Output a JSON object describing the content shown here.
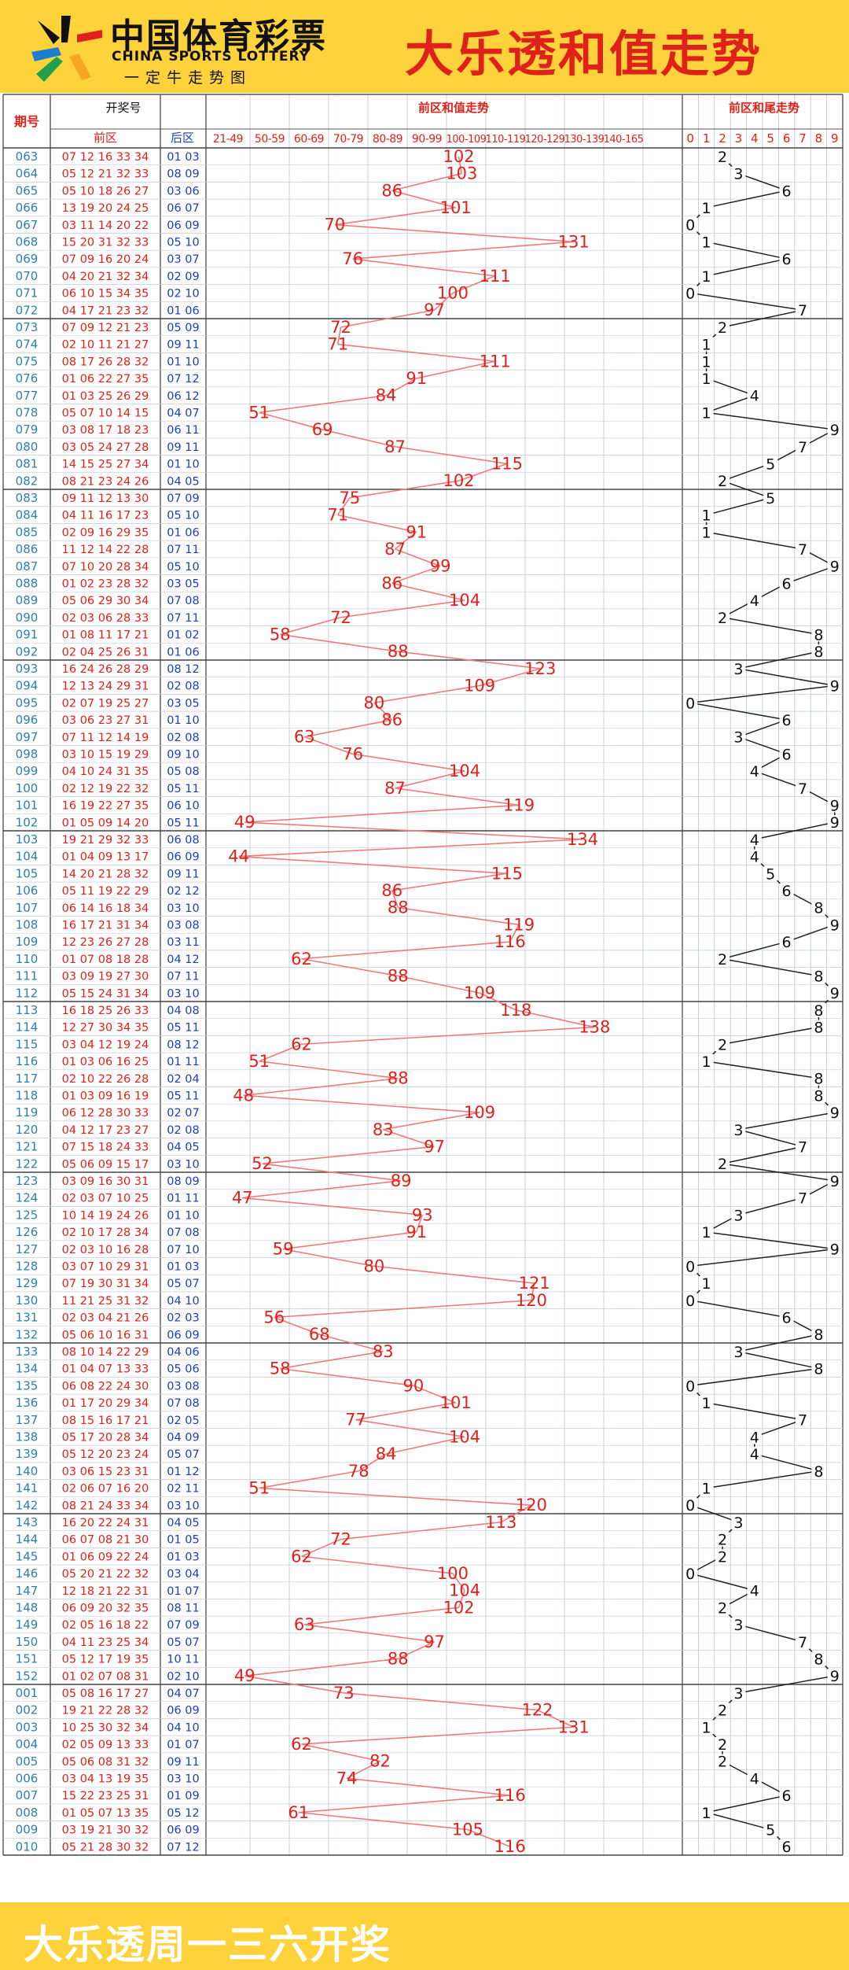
{
  "brand": {
    "name_cn": "中国体育彩票",
    "name_en": "CHINA SPORTS LOTTERY",
    "tagline": "一定牛走势图"
  },
  "title": "大乐透和值走势",
  "footer": "大乐透周一三六开奖",
  "headers": {
    "period": "期号",
    "draw": "开奖号",
    "front": "前区",
    "back": "后区",
    "sum_trend": "前区和值走势",
    "tail_trend": "前区和尾走势"
  },
  "colors": {
    "accent": "#e0201a",
    "blue": "#1a3fc0",
    "period": "#2a7fb0",
    "banner": "#fdd23a"
  },
  "chart_data": [
    {
      "type": "line",
      "title": "前区和值走势",
      "x_categories": [
        "21-49",
        "50-59",
        "60-69",
        "70-79",
        "80-89",
        "90-99",
        "100-109",
        "110-119",
        "120-129",
        "130-139",
        "140-165"
      ],
      "periods": [
        "063",
        "064",
        "065",
        "066",
        "067",
        "068",
        "069",
        "070",
        "071",
        "072",
        "073",
        "074",
        "075",
        "076",
        "077",
        "078",
        "079",
        "080",
        "081",
        "082",
        "083",
        "084",
        "085",
        "086",
        "087",
        "088",
        "089",
        "090",
        "091",
        "092",
        "093",
        "094",
        "095",
        "096",
        "097",
        "098",
        "099",
        "100",
        "101",
        "102",
        "103",
        "104",
        "105",
        "106",
        "107",
        "108",
        "109",
        "110",
        "111",
        "112",
        "113",
        "114",
        "115",
        "116",
        "117",
        "118",
        "119",
        "120",
        "121",
        "122",
        "123",
        "124",
        "125",
        "126",
        "127",
        "128",
        "129",
        "130",
        "131",
        "132",
        "133",
        "134",
        "135",
        "136",
        "137",
        "138",
        "139",
        "140",
        "141",
        "142",
        "143",
        "144",
        "145",
        "146",
        "147",
        "148",
        "149",
        "150",
        "151",
        "152",
        "001",
        "002",
        "003",
        "004",
        "005",
        "006",
        "007",
        "008",
        "009",
        "010"
      ],
      "values": [
        102,
        103,
        86,
        101,
        70,
        131,
        76,
        111,
        100,
        97,
        72,
        71,
        111,
        91,
        84,
        51,
        69,
        87,
        115,
        102,
        75,
        71,
        91,
        87,
        99,
        86,
        104,
        72,
        58,
        88,
        123,
        109,
        80,
        86,
        63,
        76,
        104,
        87,
        119,
        49,
        134,
        44,
        115,
        86,
        88,
        119,
        116,
        62,
        88,
        109,
        118,
        138,
        62,
        51,
        88,
        48,
        109,
        83,
        97,
        52,
        89,
        47,
        93,
        91,
        59,
        80,
        121,
        120,
        56,
        68,
        83,
        58,
        90,
        101,
        77,
        104,
        84,
        78,
        51,
        120,
        113,
        72,
        62,
        100,
        104,
        102,
        63,
        97,
        88,
        49,
        73,
        122,
        131,
        62,
        82,
        74,
        116,
        61,
        105,
        116
      ]
    },
    {
      "type": "line",
      "title": "前区和尾走势",
      "x_categories": [
        "0",
        "1",
        "2",
        "3",
        "4",
        "5",
        "6",
        "7",
        "8",
        "9"
      ],
      "values": [
        2,
        3,
        6,
        1,
        0,
        1,
        6,
        1,
        0,
        7,
        2,
        1,
        1,
        1,
        4,
        1,
        9,
        7,
        5,
        2,
        5,
        1,
        1,
        7,
        9,
        6,
        4,
        2,
        8,
        8,
        3,
        9,
        0,
        6,
        3,
        6,
        4,
        7,
        9,
        9,
        4,
        4,
        5,
        6,
        8,
        9,
        6,
        2,
        8,
        9,
        8,
        8,
        2,
        1,
        8,
        8,
        9,
        3,
        7,
        2,
        9,
        7,
        3,
        1,
        9,
        0,
        1,
        0,
        6,
        8,
        3,
        8,
        0,
        1,
        7,
        4,
        4,
        8,
        1,
        0,
        3,
        2,
        2,
        0,
        4,
        2,
        3,
        7,
        8,
        9,
        3,
        2,
        1,
        2,
        2,
        4,
        6,
        1,
        5,
        6
      ]
    }
  ],
  "draws": [
    {
      "p": "063",
      "f": "07 12 16 33 34",
      "b": "01 03"
    },
    {
      "p": "064",
      "f": "05 12 21 32 33",
      "b": "08 09"
    },
    {
      "p": "065",
      "f": "05 10 18 26 27",
      "b": "03 06"
    },
    {
      "p": "066",
      "f": "13 19 20 24 25",
      "b": "06 07"
    },
    {
      "p": "067",
      "f": "03 11 14 20 22",
      "b": "06 09"
    },
    {
      "p": "068",
      "f": "15 20 31 32 33",
      "b": "05 10"
    },
    {
      "p": "069",
      "f": "07 09 16 20 24",
      "b": "03 07"
    },
    {
      "p": "070",
      "f": "04 20 21 32 34",
      "b": "02 09"
    },
    {
      "p": "071",
      "f": "06 10 15 34 35",
      "b": "02 10"
    },
    {
      "p": "072",
      "f": "04 17 21 23 32",
      "b": "01 06"
    },
    {
      "p": "073",
      "f": "07 09 12 21 23",
      "b": "05 09"
    },
    {
      "p": "074",
      "f": "02 10 11 21 27",
      "b": "09 11"
    },
    {
      "p": "075",
      "f": "08 17 26 28 32",
      "b": "01 10"
    },
    {
      "p": "076",
      "f": "01 06 22 27 35",
      "b": "07 12"
    },
    {
      "p": "077",
      "f": "01 03 25 26 29",
      "b": "06 12"
    },
    {
      "p": "078",
      "f": "05 07 10 14 15",
      "b": "04 07"
    },
    {
      "p": "079",
      "f": "03 08 17 18 23",
      "b": "06 11"
    },
    {
      "p": "080",
      "f": "03 05 24 27 28",
      "b": "09 11"
    },
    {
      "p": "081",
      "f": "14 15 25 27 34",
      "b": "01 10"
    },
    {
      "p": "082",
      "f": "08 21 23 24 26",
      "b": "04 05"
    },
    {
      "p": "083",
      "f": "09 11 12 13 30",
      "b": "07 09"
    },
    {
      "p": "084",
      "f": "04 11 16 17 23",
      "b": "05 10"
    },
    {
      "p": "085",
      "f": "02 09 16 29 35",
      "b": "01 06"
    },
    {
      "p": "086",
      "f": "11 12 14 22 28",
      "b": "07 11"
    },
    {
      "p": "087",
      "f": "07 10 20 28 34",
      "b": "05 10"
    },
    {
      "p": "088",
      "f": "01 02 23 28 32",
      "b": "03 05"
    },
    {
      "p": "089",
      "f": "05 06 29 30 34",
      "b": "07 08"
    },
    {
      "p": "090",
      "f": "02 03 06 28 33",
      "b": "07 11"
    },
    {
      "p": "091",
      "f": "01 08 11 17 21",
      "b": "01 02"
    },
    {
      "p": "092",
      "f": "02 04 25 26 31",
      "b": "01 06"
    },
    {
      "p": "093",
      "f": "16 24 26 28 29",
      "b": "08 12"
    },
    {
      "p": "094",
      "f": "12 13 24 29 31",
      "b": "02 08"
    },
    {
      "p": "095",
      "f": "02 07 19 25 27",
      "b": "03 05"
    },
    {
      "p": "096",
      "f": "03 06 23 27 31",
      "b": "01 10"
    },
    {
      "p": "097",
      "f": "07 11 12 14 19",
      "b": "02 08"
    },
    {
      "p": "098",
      "f": "03 10 15 19 29",
      "b": "09 10"
    },
    {
      "p": "099",
      "f": "04 10 24 31 35",
      "b": "05 08"
    },
    {
      "p": "100",
      "f": "02 12 19 22 32",
      "b": "05 11"
    },
    {
      "p": "101",
      "f": "16 19 22 27 35",
      "b": "06 10"
    },
    {
      "p": "102",
      "f": "01 05 09 14 20",
      "b": "05 11"
    },
    {
      "p": "103",
      "f": "19 21 29 32 33",
      "b": "06 08"
    },
    {
      "p": "104",
      "f": "01 04 09 13 17",
      "b": "06 09"
    },
    {
      "p": "105",
      "f": "14 20 21 28 32",
      "b": "09 11"
    },
    {
      "p": "106",
      "f": "05 11 19 22 29",
      "b": "02 12"
    },
    {
      "p": "107",
      "f": "06 14 16 18 34",
      "b": "03 10"
    },
    {
      "p": "108",
      "f": "16 17 21 31 34",
      "b": "03 08"
    },
    {
      "p": "109",
      "f": "12 23 26 27 28",
      "b": "03 11"
    },
    {
      "p": "110",
      "f": "01 07 08 18 28",
      "b": "04 12"
    },
    {
      "p": "111",
      "f": "03 09 19 27 30",
      "b": "07 11"
    },
    {
      "p": "112",
      "f": "05 15 24 31 34",
      "b": "03 10"
    },
    {
      "p": "113",
      "f": "16 18 25 26 33",
      "b": "04 08"
    },
    {
      "p": "114",
      "f": "12 27 30 34 35",
      "b": "05 11"
    },
    {
      "p": "115",
      "f": "03 04 12 19 24",
      "b": "08 12"
    },
    {
      "p": "116",
      "f": "01 03 06 16 25",
      "b": "01 11"
    },
    {
      "p": "117",
      "f": "02 10 22 26 28",
      "b": "02 04"
    },
    {
      "p": "118",
      "f": "01 03 09 16 19",
      "b": "05 11"
    },
    {
      "p": "119",
      "f": "06 12 28 30 33",
      "b": "02 07"
    },
    {
      "p": "120",
      "f": "04 12 17 23 27",
      "b": "02 08"
    },
    {
      "p": "121",
      "f": "07 15 18 24 33",
      "b": "04 05"
    },
    {
      "p": "122",
      "f": "05 06 09 15 17",
      "b": "03 10"
    },
    {
      "p": "123",
      "f": "03 09 16 30 31",
      "b": "08 09"
    },
    {
      "p": "124",
      "f": "02 03 07 10 25",
      "b": "01 11"
    },
    {
      "p": "125",
      "f": "10 14 19 24 26",
      "b": "01 10"
    },
    {
      "p": "126",
      "f": "02 10 17 28 34",
      "b": "07 08"
    },
    {
      "p": "127",
      "f": "02 03 10 16 28",
      "b": "07 10"
    },
    {
      "p": "128",
      "f": "03 07 10 29 31",
      "b": "01 03"
    },
    {
      "p": "129",
      "f": "07 19 30 31 34",
      "b": "05 07"
    },
    {
      "p": "130",
      "f": "11 21 25 31 32",
      "b": "04 10"
    },
    {
      "p": "131",
      "f": "02 03 04 21 26",
      "b": "02 03"
    },
    {
      "p": "132",
      "f": "05 06 10 16 31",
      "b": "06 09"
    },
    {
      "p": "133",
      "f": "08 10 14 22 29",
      "b": "04 06"
    },
    {
      "p": "134",
      "f": "01 04 07 13 33",
      "b": "05 06"
    },
    {
      "p": "135",
      "f": "06 08 22 24 30",
      "b": "03 08"
    },
    {
      "p": "136",
      "f": "01 17 20 29 34",
      "b": "07 08"
    },
    {
      "p": "137",
      "f": "08 15 16 17 21",
      "b": "02 05"
    },
    {
      "p": "138",
      "f": "05 17 20 28 34",
      "b": "04 09"
    },
    {
      "p": "139",
      "f": "05 12 20 23 24",
      "b": "05 07"
    },
    {
      "p": "140",
      "f": "03 06 15 23 31",
      "b": "01 12"
    },
    {
      "p": "141",
      "f": "02 06 07 16 20",
      "b": "02 11"
    },
    {
      "p": "142",
      "f": "08 21 24 33 34",
      "b": "03 10"
    },
    {
      "p": "143",
      "f": "16 20 22 24 31",
      "b": "04 05"
    },
    {
      "p": "144",
      "f": "06 07 08 21 30",
      "b": "01 05"
    },
    {
      "p": "145",
      "f": "01 06 09 22 24",
      "b": "01 03"
    },
    {
      "p": "146",
      "f": "05 20 21 22 32",
      "b": "03 04"
    },
    {
      "p": "147",
      "f": "12 18 21 22 31",
      "b": "01 07"
    },
    {
      "p": "148",
      "f": "06 09 20 32 35",
      "b": "08 11"
    },
    {
      "p": "149",
      "f": "02 05 16 18 22",
      "b": "07 09"
    },
    {
      "p": "150",
      "f": "04 11 23 25 34",
      "b": "05 07"
    },
    {
      "p": "151",
      "f": "05 12 17 19 35",
      "b": "10 11"
    },
    {
      "p": "152",
      "f": "01 02 07 08 31",
      "b": "02 10"
    },
    {
      "p": "001",
      "f": "05 08 16 17 27",
      "b": "04 07"
    },
    {
      "p": "002",
      "f": "19 21 22 28 32",
      "b": "06 09"
    },
    {
      "p": "003",
      "f": "10 25 30 32 34",
      "b": "04 10"
    },
    {
      "p": "004",
      "f": "02 05 09 13 33",
      "b": "01 07"
    },
    {
      "p": "005",
      "f": "05 06 08 31 32",
      "b": "09 11"
    },
    {
      "p": "006",
      "f": "03 04 13 19 35",
      "b": "03 10"
    },
    {
      "p": "007",
      "f": "15 22 23 25 31",
      "b": "01 09"
    },
    {
      "p": "008",
      "f": "01 05 07 13 35",
      "b": "05 12"
    },
    {
      "p": "009",
      "f": "03 19 21 30 32",
      "b": "06 09"
    },
    {
      "p": "010",
      "f": "05 21 28 30 32",
      "b": "07 12"
    }
  ]
}
